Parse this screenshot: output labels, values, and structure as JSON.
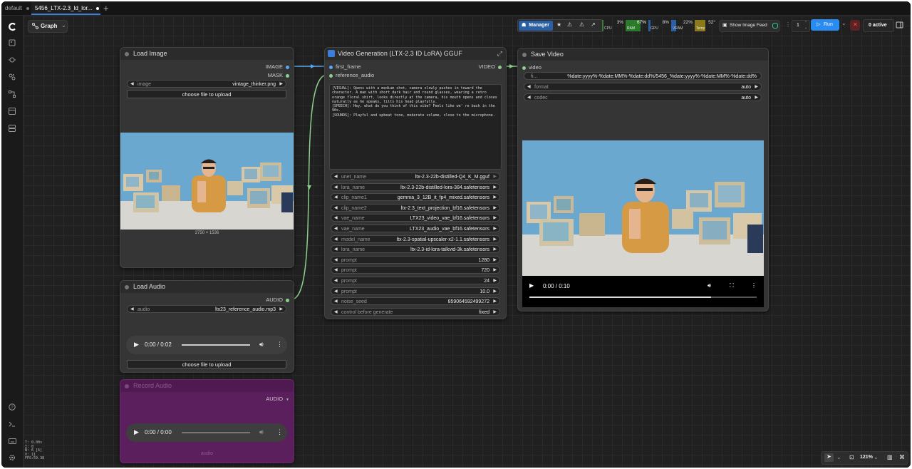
{
  "tabs": [
    {
      "label": "default"
    },
    {
      "label": "5456_LTX-2.3_ld_lor..."
    }
  ],
  "topbar": {
    "graph_label": "Graph",
    "manager_label": "Manager",
    "cpu_pct": "3%",
    "cpu_label": "CPU",
    "ram_pct": "67%",
    "ram_label": "RAM",
    "gpu_pct": "8%",
    "gpu_label": "GPU",
    "vram_pct": "22%",
    "vram_label": "VRAM",
    "temp_value": "52°",
    "temp_label": "Temp",
    "show_image_feed": "Show Image Feed",
    "queue_count": "1",
    "run_label": "Run",
    "active_label": "0 active"
  },
  "load_image": {
    "title": "Load Image",
    "out_image": "IMAGE",
    "out_mask": "MASK",
    "image_label": "image",
    "image_value": "vintage_thinker.png",
    "upload_label": "choose file to upload",
    "dimensions": "2750 × 1536"
  },
  "load_audio": {
    "title": "Load Audio",
    "out_audio": "AUDIO",
    "audio_label": "audio",
    "audio_value": "ltx23_reference_audio.mp3",
    "time": "0:00 / 0:02",
    "upload_label": "choose file to upload"
  },
  "record_audio": {
    "title": "Record Audio",
    "out_audio": "AUDIO",
    "time": "0:00 / 0:00",
    "footer": "audio"
  },
  "video_gen": {
    "title": "Video Generation (LTX-2.3 ID LoRA) GGUF",
    "in_first_frame": "first_frame",
    "in_reference_audio": "reference_audio",
    "out_video": "VIDEO",
    "prompt_text": "[VISUAL]: Opens with a medium shot, camera slowly pushes in toward the character. A man with short dark hair and round glasses, wearing a retro orange floral shirt, looks directly at the camera, his mouth opens and closes naturally as he speaks, tilts his head playfully.\n[SPEECH]: Hey, what do you think of this vibe? Feels like we' re back in the 90s.\n[SOUNDS]: Playful and upbeat tone, moderate volume, close to the microphone.",
    "widgets": [
      {
        "label": "unet_name",
        "value": "ltx-2.3-22b-distilled-Q4_K_M.gguf"
      },
      {
        "label": "lora_name",
        "value": "ltx-2.3-22b-distilled-lora-384.safetensors"
      },
      {
        "label": "clip_name1",
        "value": "gemma_3_12B_it_fp4_mixed.safetensors"
      },
      {
        "label": "clip_name2",
        "value": "ltx-2.3_text_projection_bf16.safetensors"
      },
      {
        "label": "vae_name",
        "value": "LTX23_video_vae_bf16.safetensors"
      },
      {
        "label": "vae_name",
        "value": "LTX23_audio_vae_bf16.safetensors"
      },
      {
        "label": "model_name",
        "value": "ltx-2.3-spatial-upscaler-x2-1.1.safetensors"
      },
      {
        "label": "lora_name",
        "value": "ltx-2.3-id-lora-talkvid-3k.safetensors"
      },
      {
        "label": "prompt",
        "value": "1280"
      },
      {
        "label": "prompt",
        "value": "720"
      },
      {
        "label": "prompt",
        "value": "24"
      },
      {
        "label": "prompt",
        "value": "10.0"
      },
      {
        "label": "noise_seed",
        "value": "859064592499272"
      },
      {
        "label": "control before generate",
        "value": "fixed"
      }
    ]
  },
  "save_video": {
    "title": "Save Video",
    "in_video": "video",
    "filename_label": "fi...",
    "filename_value": "%date:yyyy%-%date:MM%-%date:dd%/5456_%date:yyyy%-%date:MM%-%date:dd%",
    "format_label": "format",
    "format_value": "auto",
    "codec_label": "codec",
    "codec_value": "auto",
    "time": "0:00 / 0:10"
  },
  "status": {
    "line1": "T: 0.00s",
    "line2": "I: 0",
    "line3": "N: 6 [6]",
    "line4": "V: 11",
    "line5": "FPS:59.38"
  },
  "bottom_right": {
    "zoom": "121%"
  },
  "colors": {
    "accent_blue": "#3d7fd8",
    "record_node_purple": "#5a1f5c",
    "link_green": "#8cd08c",
    "link_blue": "#5aa7f0",
    "run_button": "#2a8cf0",
    "stop_button": "#c23b3b"
  }
}
